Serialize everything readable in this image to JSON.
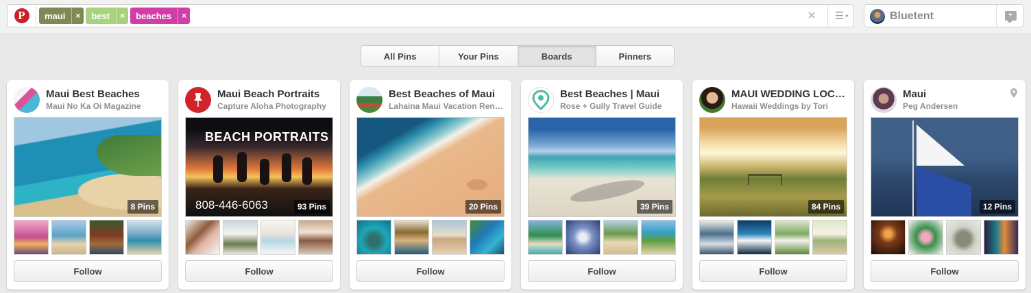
{
  "header": {
    "logo_letter": "P",
    "search_tokens": [
      {
        "label": "maui",
        "color": "#7d8a55"
      },
      {
        "label": "best",
        "color": "#a8d27c"
      },
      {
        "label": "beaches",
        "color": "#d23ea7"
      }
    ],
    "token_remove_glyph": "×",
    "clear_glyph": "×",
    "menu_glyph": "☰",
    "menu_caret": "▾",
    "user_name": "Bluetent",
    "message_glyph": "+"
  },
  "tabs": [
    {
      "label": "All Pins",
      "active": false
    },
    {
      "label": "Your Pins",
      "active": false
    },
    {
      "label": "Boards",
      "active": true
    },
    {
      "label": "Pinners",
      "active": false
    }
  ],
  "boards": [
    {
      "title": "Maui Best Beaches",
      "owner": "Maui No Ka Oi Magazine",
      "pins": "8 Pins",
      "follow": "Follow"
    },
    {
      "title": "Maui Beach Portraits",
      "owner": "Capture Aloha Photography",
      "pins": "93 Pins",
      "follow": "Follow",
      "cover_title": "BEACH PORTRAITS",
      "cover_phone": "808-446-6063"
    },
    {
      "title": "Best Beaches of Maui",
      "owner": "Lahaina Maui Vacation Rentals",
      "pins": "20 Pins",
      "follow": "Follow"
    },
    {
      "title": "Best Beaches | Maui",
      "owner": "Rose + Gully Travel Guide",
      "pins": "39 Pins",
      "follow": "Follow"
    },
    {
      "title": "MAUI WEDDING LOCATIONS",
      "owner": "Hawaii Weddings by Tori",
      "pins": "84 Pins",
      "follow": "Follow"
    },
    {
      "title": "Maui",
      "owner": "Peg Andersen",
      "pins": "12 Pins",
      "follow": "Follow",
      "location_icon": "map-pin-icon"
    }
  ],
  "colors": {
    "brand_red": "#cb2027",
    "background": "#e9e9e9"
  }
}
